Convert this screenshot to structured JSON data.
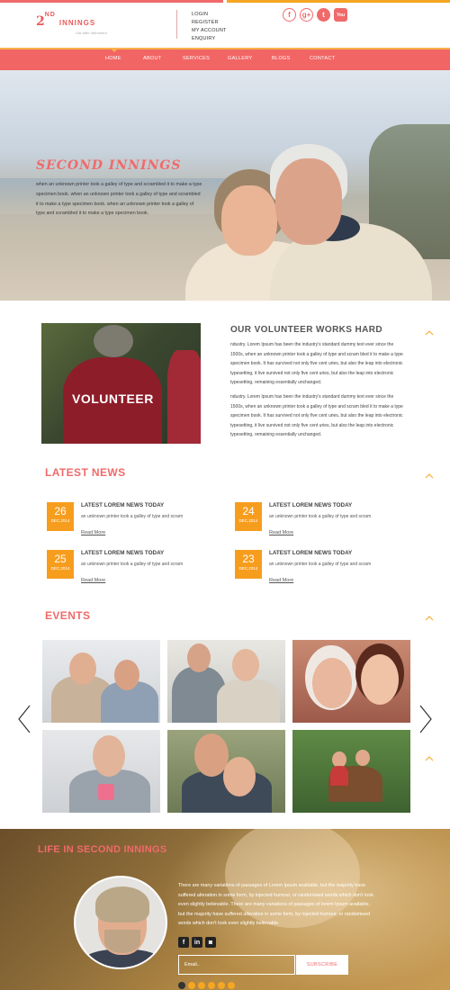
{
  "header": {
    "logo_number": "2",
    "logo_sup": "ND",
    "logo_word": "INNINGS",
    "tagline": "Life after retirement",
    "links": [
      "LOGIN",
      "REGISTER",
      "MY ACCOUNT",
      "ENQUIRY"
    ],
    "social_icons": [
      "facebook-icon",
      "google-plus-icon",
      "twitter-icon",
      "youtube-icon"
    ]
  },
  "nav": {
    "items": [
      "HOME",
      "ABOUT",
      "SERVICES",
      "GALLERY",
      "BLOGS",
      "CONTACT"
    ],
    "active": "HOME"
  },
  "hero": {
    "title": "SECOND INNINGS",
    "text": "when an unknown printer took a galley of type and scrambled it to make a type specimen book. when an unknown printer took a galley of type and scrambled it to make a type specimen book. when an unknown printer took a galley of type and scrambled it to make a type specimen book."
  },
  "volunteer": {
    "image_word": "VOLUNTEER",
    "title": "OUR VOLUNTEER WORKS HARD",
    "p1": "ndustry. Lorem Ipsum has been the industry's standard dummy text ever since the 1500s, when an unknown printer took a galley of type and scram bled it to make a type specimen book. It has survived not only five cent uries, but also the leap into electronic typesetting, it live survived not only five cent uries, but also the leap into electronic typesetting, remaining essentially unchanged.",
    "p2": "ndustry. Lorem Ipsum has been the industry's standard dummy text ever since the 1500s, when an unknown printer took a galley of type and scram bled it to make a type specimen book. It has survived not only five cent uries, but also the leap into electronic typesetting, it live survived not only five cent uries, but also the leap into electronic typesetting, remaining essentially unchanged."
  },
  "news": {
    "title": "LATEST NEWS",
    "items": [
      {
        "day": "26",
        "month": "DEC,2014",
        "title": "LATEST LOREM NEWS TODAY",
        "text": "an unknown printer took a galley of type and scram",
        "read_more": "Read More"
      },
      {
        "day": "24",
        "month": "DEC,2014",
        "title": "LATEST LOREM NEWS TODAY",
        "text": "an unknown printer took a galley of type and scram",
        "read_more": "Read More"
      },
      {
        "day": "25",
        "month": "DEC,2014",
        "title": "LATEST LOREM NEWS TODAY",
        "text": "an unknown printer took a galley of type and scram",
        "read_more": "Read More"
      },
      {
        "day": "23",
        "month": "DEC,2014",
        "title": "LATEST LOREM NEWS TODAY",
        "text": "an unknown printer took a galley of type and scram",
        "read_more": "Read More"
      }
    ]
  },
  "events": {
    "title": "EVENTS"
  },
  "bottom": {
    "title": "LIFE IN SECOND INNINGS",
    "text": "There are many variations of passages of Lorem Ipsum available, but the majority have suffered alteration in some form, by injected humour, or randomised words which don't look even slightly believable. There are many variations of passages of lorem Ipsum available, but the majority have suffered alteration in some form, by injected humour, or randomised words which don't look even slightly believable.",
    "social_icons": [
      "facebook-icon",
      "linkedin-icon",
      "instagram-icon"
    ],
    "email_placeholder": "Email..",
    "subscribe_label": "SUBSCRIBE"
  },
  "colors": {
    "accent": "#f06a6a",
    "secondary": "#f5a623",
    "date_badge": "#f79d1e"
  }
}
